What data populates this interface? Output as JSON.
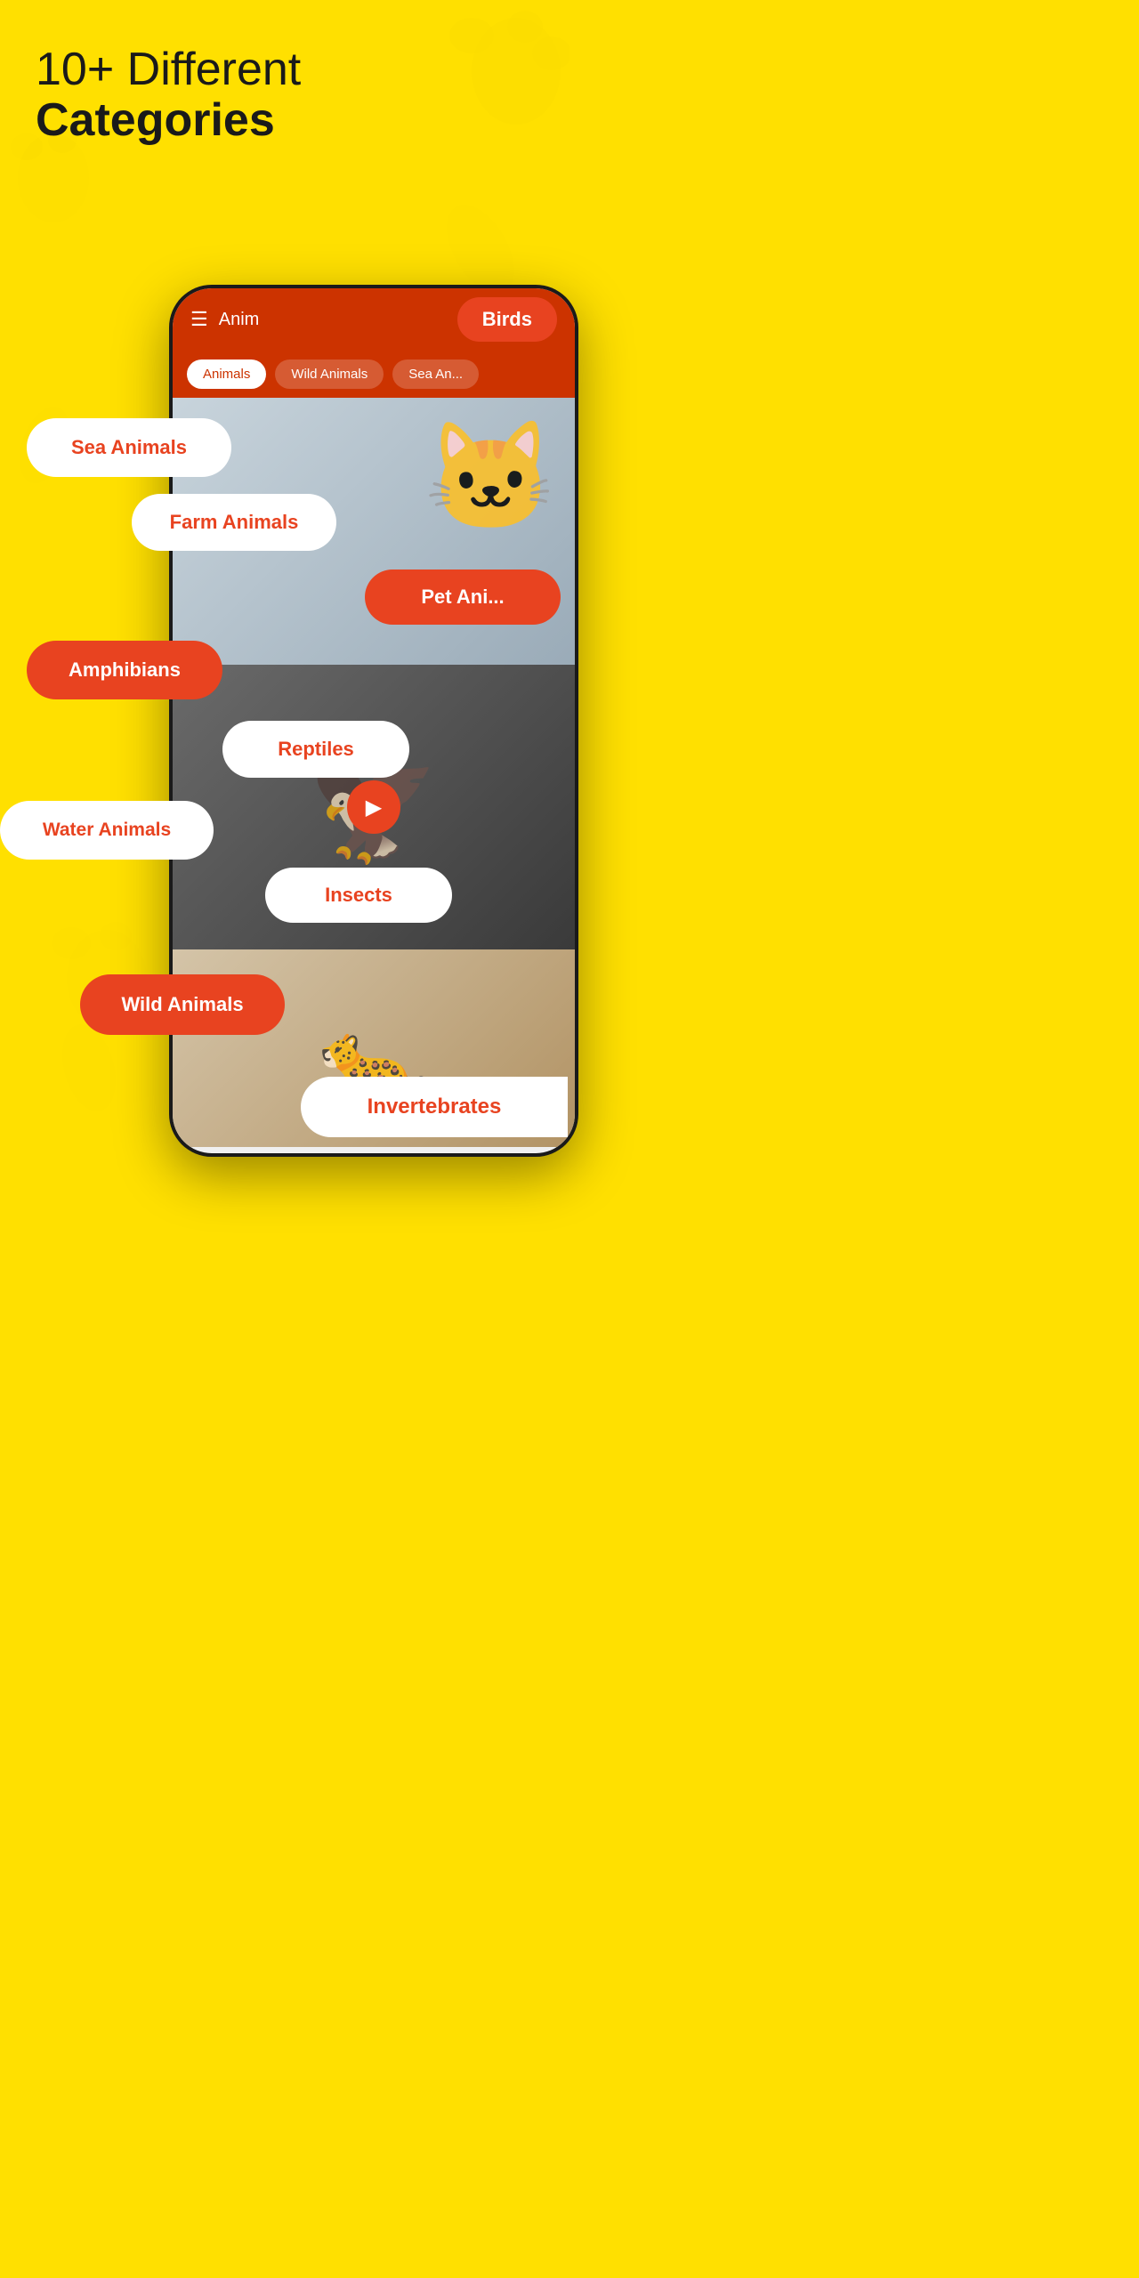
{
  "headline": {
    "line1": "10+ Different",
    "line2": "Categories"
  },
  "phone": {
    "topbar_title": "Anim",
    "hamburger": "☰",
    "birds_button": "Birds",
    "filter_tabs": [
      "Animals",
      "Wild Animals",
      "Sea An..."
    ]
  },
  "badges": {
    "birds": "Birds",
    "sea_animals": "Sea Animals",
    "farm_animals": "Farm Animals",
    "pet_animals": "Pet Ani...",
    "amphibians": "Amphibians",
    "reptiles": "Reptiles",
    "water_animals": "Water Animals",
    "insects": "Insects",
    "wild_animals": "Wild Animals",
    "invertebrates": "Invertebrates"
  },
  "colors": {
    "background_yellow": "#FFE000",
    "red_primary": "#E84320",
    "dark_red": "#CC3300",
    "white": "#FFFFFF",
    "text_dark": "#1a1a1a"
  }
}
